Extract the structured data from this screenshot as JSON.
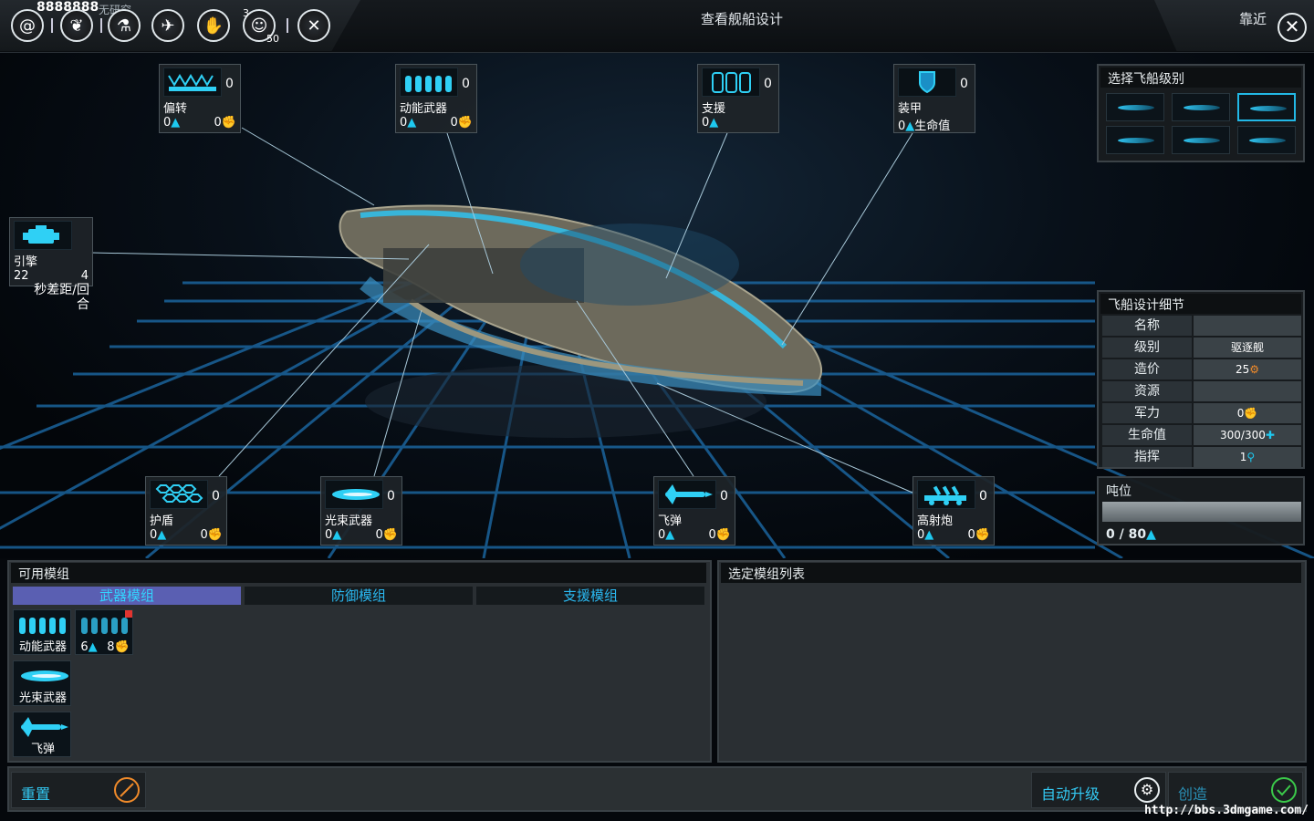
{
  "topbar": {
    "resource_value": "8888888",
    "resource_sub": "无研究",
    "page_title": "查看舰船设计",
    "zoom_label": "靠近",
    "badge_count": "3",
    "badge_sub": "50"
  },
  "slots": {
    "deflect": {
      "name": "偏转",
      "count": "0",
      "a": "0",
      "b": "0"
    },
    "kinetic": {
      "name": "动能武器",
      "count": "0",
      "a": "0",
      "b": "0"
    },
    "support": {
      "name": "支援",
      "count": "0",
      "a": "0"
    },
    "armor": {
      "name": "装甲",
      "count": "0",
      "a": "0",
      "b": "生命值"
    },
    "engine": {
      "name": "引擎",
      "a": "22",
      "b": "4",
      "note": "秒差距/回合"
    },
    "shield": {
      "name": "护盾",
      "count": "0",
      "a": "0",
      "b": "0"
    },
    "beam": {
      "name": "光束武器",
      "count": "0",
      "a": "0",
      "b": "0"
    },
    "missile": {
      "name": "飞弹",
      "count": "0",
      "a": "0",
      "b": "0"
    },
    "artillery": {
      "name": "高射炮",
      "count": "0",
      "a": "0",
      "b": "0"
    }
  },
  "class_select": {
    "title": "选择飞船级别"
  },
  "details": {
    "title": "飞船设计细节",
    "rows": [
      {
        "k": "名称",
        "v": ""
      },
      {
        "k": "级别",
        "v": "驱逐舰"
      },
      {
        "k": "造价",
        "v": "25"
      },
      {
        "k": "资源",
        "v": ""
      },
      {
        "k": "军力",
        "v": "0"
      },
      {
        "k": "生命值",
        "v": "300/300"
      },
      {
        "k": "指挥",
        "v": "1"
      }
    ]
  },
  "tonnage": {
    "title": "吨位",
    "value": "0 / 80",
    "fill": 0
  },
  "available": {
    "title": "可用模组",
    "tabs": [
      "武器模组",
      "防御模组",
      "支援模组"
    ],
    "modules": [
      {
        "label": "动能武器"
      },
      {
        "label": "",
        "a": "6",
        "b": "8"
      },
      {
        "label": "光束武器"
      },
      {
        "label": "飞弹"
      }
    ]
  },
  "selected": {
    "title": "选定模组列表"
  },
  "footer": {
    "reset": "重置",
    "auto_upgrade": "自动升级",
    "create": "创造",
    "watermark": "http://bbs.3dmgame.com/"
  },
  "colors": {
    "accent": "#1ec9f0",
    "tab_active": "#5a5fb2",
    "confirm": "#3bc94a",
    "cancel": "#ef8a2a"
  }
}
